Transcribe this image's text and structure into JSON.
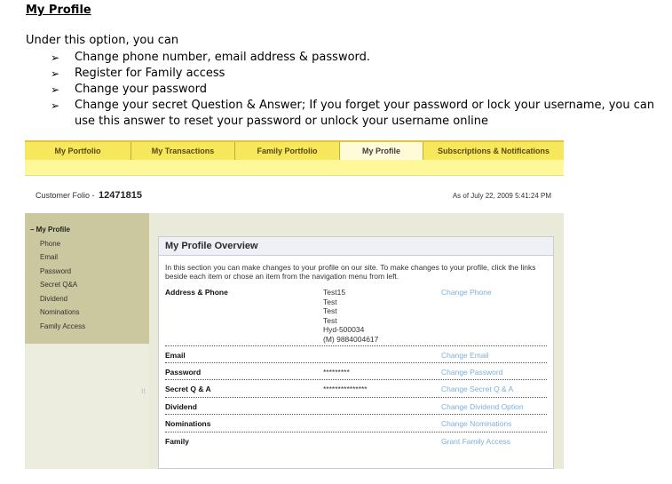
{
  "doc": {
    "title": "My Profile",
    "intro": "Under this option, you can",
    "bullets": [
      "Change phone number, email address & password.",
      "Register for Family access",
      "Change your password",
      "Change your secret Question & Answer; If you forget your password or lock your username, you can use this answer to reset your password or unlock your username online"
    ],
    "bullet_icon": "arrow-right-icon"
  },
  "nav": {
    "tabs": [
      "My Portfolio",
      "My Transactions",
      "Family Portfolio",
      "My Profile",
      "Subscriptions & Notifications"
    ],
    "active_tab": "My Profile"
  },
  "folio": {
    "label": "Customer Folio -",
    "number": "12471815",
    "as_of": "As of July 22, 2009 5:41:24 PM"
  },
  "sidebar": {
    "heading": "– My Profile",
    "items": [
      "Phone",
      "Email",
      "Password",
      "Secret Q&A",
      "Dividend",
      "Nominations",
      "Family Access"
    ],
    "grip": "⁞⁞"
  },
  "overview": {
    "title": "My Profile Overview",
    "intro": "In this section you can make changes to your profile on our site. To make changes to your profile, click the links beside each item or chose an item from the navigation menu from left.",
    "address": {
      "label": "Address & Phone",
      "lines": [
        "Test15",
        "Test",
        "Test",
        "Test",
        "Hyd-500034",
        "(M) 9884004617"
      ],
      "link": "Change Phone"
    },
    "rows": [
      {
        "label": "Email",
        "value": "",
        "link": "Change Email"
      },
      {
        "label": "Password",
        "value": "*********",
        "link": "Change Password"
      },
      {
        "label": "Secret Q & A",
        "value": "***************",
        "link": "Change Secret Q & A"
      },
      {
        "label": "Dividend",
        "value": "",
        "link": "Change Dividend Option"
      },
      {
        "label": "Nominations",
        "value": "",
        "link": "Change Nominations"
      },
      {
        "label": "Family",
        "value": "",
        "link": "Grant Family Access"
      }
    ]
  },
  "colors": {
    "tab_bar": "#f6e75c",
    "sub_bar": "#fff89a",
    "sidebar_menu": "#cbc79e",
    "content_bg": "#eaeadb",
    "link": "#7fb0d6"
  }
}
